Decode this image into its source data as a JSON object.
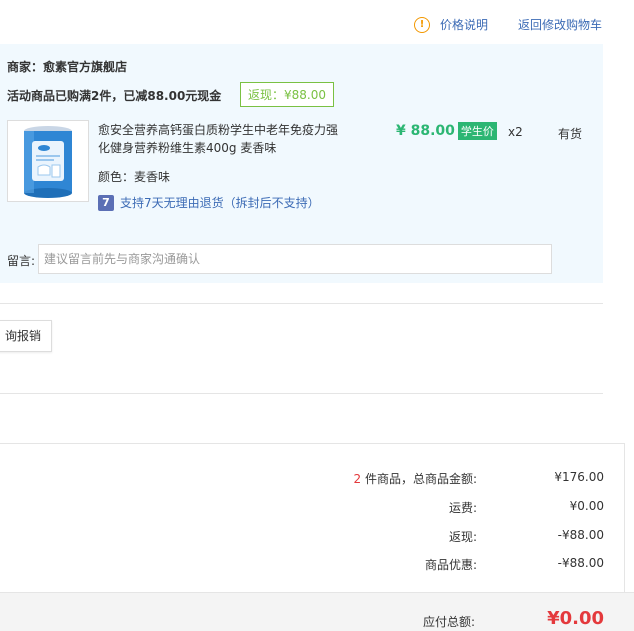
{
  "top": {
    "price_note": "价格说明",
    "back_to_cart": "返回修改购物车"
  },
  "shop": {
    "merchant": "商家：愈素官方旗舰店",
    "promo": "活动商品已购满2件，已减88.00元现金",
    "rebate_badge": "返现：¥88.00",
    "product": {
      "name": "愈安全营养高钙蛋白质粉学生中老年免疫力强化健身营养粉维生素400g 麦香味",
      "color": "颜色：麦香味",
      "return_policy": "支持7天无理由退货（拆封后不支持）",
      "return_icon_text": "7",
      "price": "¥ 88.00",
      "price_tag": "学生价",
      "qty": "x2",
      "stock": "有货"
    },
    "message": {
      "label": "留言:",
      "placeholder": "建议留言前先与商家沟通确认"
    }
  },
  "reimburse_button": "询报销",
  "summary": {
    "count": "2",
    "count_suffix": " 件商品，总商品金额:",
    "goods_total": "¥176.00",
    "shipping_label": "运费:",
    "shipping": "¥0.00",
    "rebate_label": "返现:",
    "rebate": "-¥88.00",
    "discount_label": "商品优惠:",
    "discount": "-¥88.00",
    "total_label": "应付总额:",
    "total": "¥0.00"
  },
  "colors": {
    "link_blue": "#3c6bb5",
    "green": "#2cb673",
    "red": "#e4393c",
    "block_bg": "#f1f9fe",
    "warn_orange": "#f39800"
  }
}
